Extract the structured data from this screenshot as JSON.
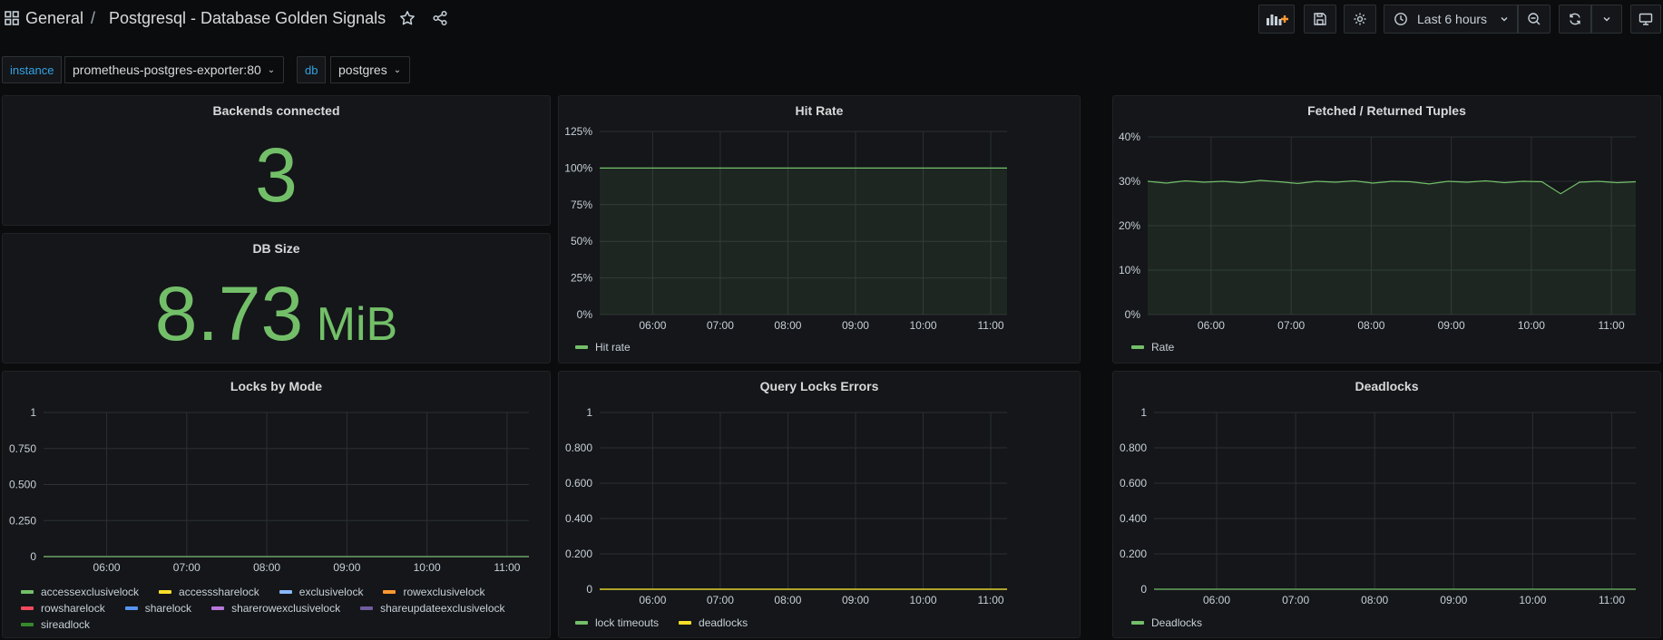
{
  "topbar": {
    "breadcrumb_folder": "General",
    "breadcrumb_separator": "/",
    "dashboard_title": "Postgresql - Database Golden Signals",
    "time_range": "Last 6 hours"
  },
  "variables": [
    {
      "label": "instance",
      "value": "prometheus-postgres-exporter:80"
    },
    {
      "label": "db",
      "value": "postgres"
    }
  ],
  "colors": {
    "green": "#73bf69",
    "yellow": "#fade2a",
    "cyan": "#5794f2"
  },
  "panels": {
    "backends": {
      "title": "Backends connected",
      "value": "3"
    },
    "dbsize": {
      "title": "DB Size",
      "value": "8.73",
      "unit": "MiB"
    }
  },
  "chart_data": [
    {
      "id": "hit_rate",
      "type": "area",
      "title": "Hit Rate",
      "x_ticks": [
        "06:00",
        "07:00",
        "08:00",
        "09:00",
        "10:00",
        "11:00"
      ],
      "y_ticks": [
        "0%",
        "25%",
        "50%",
        "75%",
        "100%",
        "125%"
      ],
      "ylim": [
        0,
        125
      ],
      "series": [
        {
          "name": "Hit rate",
          "color": "#73bf69",
          "values": [
            100,
            100,
            100,
            100,
            100,
            100,
            100
          ]
        }
      ]
    },
    {
      "id": "tuples",
      "type": "area",
      "title": "Fetched / Returned Tuples",
      "x_ticks": [
        "06:00",
        "07:00",
        "08:00",
        "09:00",
        "10:00",
        "11:00"
      ],
      "y_ticks": [
        "0%",
        "10%",
        "20%",
        "30%",
        "40%"
      ],
      "ylim": [
        0,
        40
      ],
      "series": [
        {
          "name": "Rate",
          "color": "#73bf69",
          "values": [
            30,
            29.6,
            30.1,
            29.8,
            30,
            29.7,
            30.2,
            29.9,
            29.5,
            30,
            29.8,
            30.1,
            29.6,
            30,
            29.9,
            29.4,
            30,
            29.8,
            30.1,
            29.7,
            30,
            29.9,
            27.2,
            29.8,
            30,
            29.7,
            29.9
          ]
        }
      ]
    },
    {
      "id": "locks",
      "type": "line",
      "title": "Locks by Mode",
      "x_ticks": [
        "06:00",
        "07:00",
        "08:00",
        "09:00",
        "10:00",
        "11:00"
      ],
      "y_ticks": [
        "0",
        "0.250",
        "0.500",
        "0.750",
        "1"
      ],
      "ylim": [
        0,
        1
      ],
      "series": [
        {
          "name": "accessexclusivelock",
          "color": "#73bf69",
          "values": [
            0,
            0
          ]
        },
        {
          "name": "accesssharelock",
          "color": "#fade2a",
          "values": [
            0,
            0
          ]
        },
        {
          "name": "exclusivelock",
          "color": "#8ab8ff",
          "values": [
            0,
            0
          ]
        },
        {
          "name": "rowexclusivelock",
          "color": "#ff9830",
          "values": [
            0,
            0
          ]
        },
        {
          "name": "rowsharelock",
          "color": "#f2495c",
          "values": [
            0,
            0
          ]
        },
        {
          "name": "sharelock",
          "color": "#5794f2",
          "values": [
            0,
            0
          ]
        },
        {
          "name": "sharerowexclusivelock",
          "color": "#b877d9",
          "values": [
            0,
            0
          ]
        },
        {
          "name": "shareupdateexclusivelock",
          "color": "#705da0",
          "values": [
            0,
            0
          ]
        },
        {
          "name": "sireadlock",
          "color": "#37872d",
          "values": [
            0,
            0
          ]
        }
      ]
    },
    {
      "id": "query_locks",
      "type": "line",
      "title": "Query Locks Errors",
      "x_ticks": [
        "06:00",
        "07:00",
        "08:00",
        "09:00",
        "10:00",
        "11:00"
      ],
      "y_ticks": [
        "0",
        "0.200",
        "0.400",
        "0.600",
        "0.800",
        "1"
      ],
      "ylim": [
        0,
        1
      ],
      "series": [
        {
          "name": "lock timeouts",
          "color": "#73bf69",
          "values": [
            0,
            0
          ]
        },
        {
          "name": "deadlocks",
          "color": "#fade2a",
          "values": [
            0,
            0
          ]
        }
      ]
    },
    {
      "id": "deadlocks",
      "type": "line",
      "title": "Deadlocks",
      "x_ticks": [
        "06:00",
        "07:00",
        "08:00",
        "09:00",
        "10:00",
        "11:00"
      ],
      "y_ticks": [
        "0",
        "0.200",
        "0.400",
        "0.600",
        "0.800",
        "1"
      ],
      "ylim": [
        0,
        1
      ],
      "series": [
        {
          "name": "Deadlocks",
          "color": "#73bf69",
          "values": [
            0,
            0
          ]
        }
      ]
    }
  ]
}
